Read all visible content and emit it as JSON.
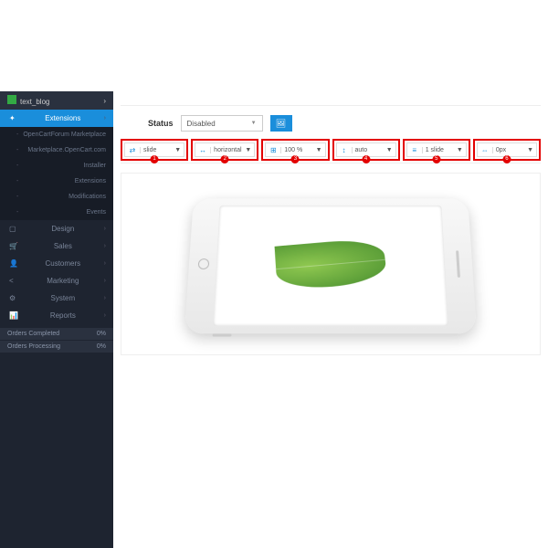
{
  "sidebar": {
    "top": "text_blog",
    "items": [
      {
        "label": "Extensions",
        "active": true,
        "icon": "✦"
      },
      {
        "label": "OpenCartForum Marketplace",
        "sub": true
      },
      {
        "label": "Marketplace.OpenCart.com",
        "sub": true
      },
      {
        "label": "Installer",
        "sub": true
      },
      {
        "label": "Extensions",
        "sub": true
      },
      {
        "label": "Modifications",
        "sub": true
      },
      {
        "label": "Events",
        "sub": true
      },
      {
        "label": "Design",
        "icon": "▢"
      },
      {
        "label": "Sales",
        "icon": "🛒"
      },
      {
        "label": "Customers",
        "icon": "👤"
      },
      {
        "label": "Marketing",
        "icon": "<"
      },
      {
        "label": "System",
        "icon": "⚙"
      },
      {
        "label": "Reports",
        "icon": "📊"
      }
    ],
    "stats": [
      {
        "label": "Orders Completed",
        "val": "0%"
      },
      {
        "label": "Orders Processing",
        "val": "0%"
      }
    ]
  },
  "toolbar": {
    "status_label": "Status",
    "status_value": "Disabled"
  },
  "options": [
    {
      "num": "1",
      "icon": "⇄",
      "value": "slide"
    },
    {
      "num": "2",
      "icon": "↔",
      "value": "horizontal"
    },
    {
      "num": "3",
      "icon": "⊞",
      "value": "100 %"
    },
    {
      "num": "4",
      "icon": "↕",
      "value": "auto"
    },
    {
      "num": "5",
      "icon": "≡",
      "value": "1 slide"
    },
    {
      "num": "6",
      "icon": "⇔",
      "value": "0px"
    }
  ]
}
